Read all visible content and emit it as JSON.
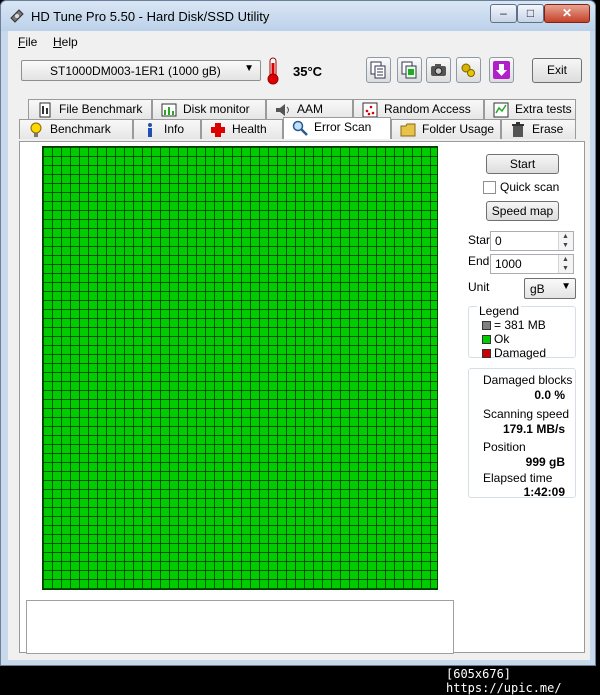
{
  "window": {
    "title": "HD Tune Pro 5.50 - Hard Disk/SSD Utility",
    "min": "–",
    "max": "□",
    "close": "✕"
  },
  "menu": {
    "file_u": "F",
    "file_rest": "ile",
    "help_u": "H",
    "help_rest": "elp"
  },
  "toolbar": {
    "drive": "ST1000DM003-1ER1 (1000 gB)",
    "temperature": "35",
    "temperature_unit": "°C",
    "exit_label": "Exit"
  },
  "tabs_top": [
    {
      "label": "File Benchmark",
      "icon": "file-benchmark-icon"
    },
    {
      "label": "Disk monitor",
      "icon": "disk-monitor-icon"
    },
    {
      "label": "AAM",
      "icon": "speaker-icon"
    },
    {
      "label": "Random Access",
      "icon": "random-access-icon"
    },
    {
      "label": "Extra tests",
      "icon": "extra-tests-icon"
    }
  ],
  "tabs_bottom": [
    {
      "label": "Benchmark",
      "icon": "bulb-icon"
    },
    {
      "label": "Info",
      "icon": "info-icon"
    },
    {
      "label": "Health",
      "icon": "health-cross-icon"
    },
    {
      "label": "Error Scan",
      "icon": "magnifier-icon",
      "active": true
    },
    {
      "label": "Folder Usage",
      "icon": "folder-icon"
    },
    {
      "label": "Erase",
      "icon": "trash-icon"
    }
  ],
  "scan": {
    "start_button": "Start",
    "quick_scan_label": "Quick scan",
    "quick_scan_checked": false,
    "speed_map_button": "Speed map",
    "start_label": "Start",
    "start_value": "0",
    "end_label": "End",
    "end_value": "1000",
    "unit_label": "Unit",
    "unit_value": "gB"
  },
  "legend": {
    "title": "Legend",
    "block": "= 381 MB",
    "ok": "Ok",
    "damaged": "Damaged",
    "colors": {
      "block": "#808080",
      "ok": "#00cc00",
      "damaged": "#cc0000"
    }
  },
  "stats": {
    "damaged_blocks_label": "Damaged blocks",
    "damaged_blocks_value": "0.0 %",
    "scanning_speed_label": "Scanning speed",
    "scanning_speed_value": "179.1 MB/s",
    "position_label": "Position",
    "position_value": "999 gB",
    "elapsed_label": "Elapsed time",
    "elapsed_value": "1:42:09"
  },
  "scan_grid": {
    "status": "all blocks ok",
    "color": "#00cc00"
  },
  "footer": {
    "text": "[605x676] https://upic.me/"
  }
}
